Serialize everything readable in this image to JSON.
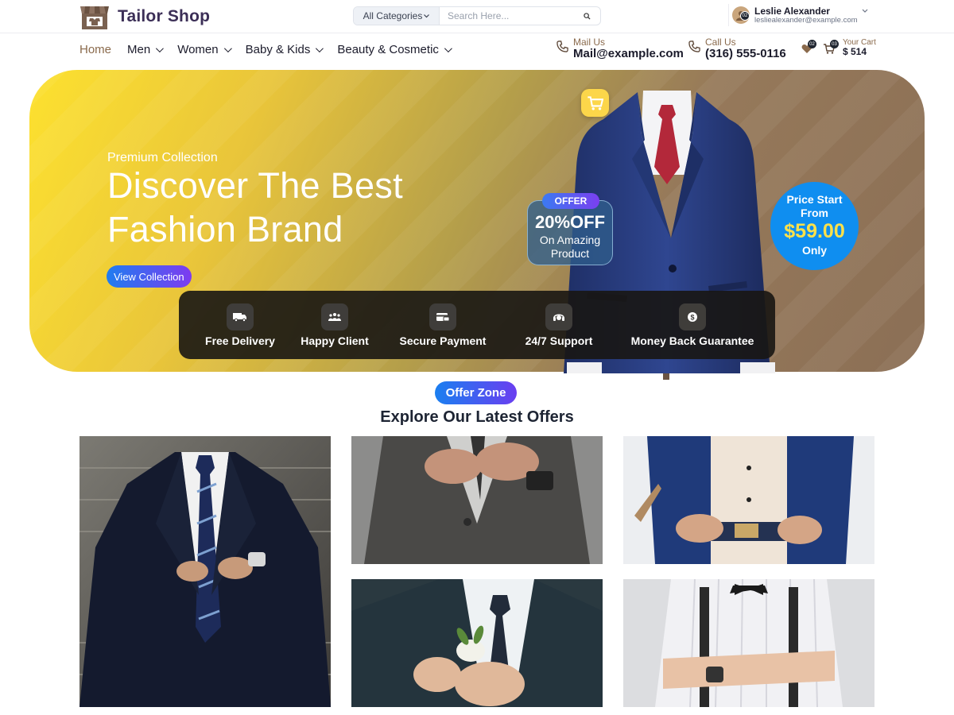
{
  "brand": {
    "name": "Tailor Shop"
  },
  "search": {
    "category": "All Categories",
    "placeholder": "Search Here..."
  },
  "user": {
    "name": "Leslie Alexander",
    "email": "lesliealexander@example.com",
    "badge": "02"
  },
  "nav": {
    "items": [
      {
        "label": "Home",
        "dropdown": false,
        "active": true
      },
      {
        "label": "Men",
        "dropdown": true,
        "active": false
      },
      {
        "label": "Women",
        "dropdown": true,
        "active": false
      },
      {
        "label": "Baby & Kids",
        "dropdown": true,
        "active": false
      },
      {
        "label": "Beauty & Cosmetic",
        "dropdown": true,
        "active": false
      }
    ]
  },
  "contact": {
    "mail_label": "Mail Us",
    "mail_value": "Mail@example.com",
    "call_label": "Call Us",
    "call_value": "(316) 555-0116"
  },
  "cart": {
    "wishlist_badge": "02",
    "cart_badge": "03",
    "label": "Your Cart",
    "value": "$ 514"
  },
  "hero": {
    "subtitle": "Premium Collection",
    "title_line1": "Discover The Best",
    "title_line2": "Fashion Brand",
    "button": "View Collection",
    "offer_tag": "OFFER",
    "offer_pct": "20%OFF",
    "offer_desc1": "On Amazing",
    "offer_desc2": "Product",
    "price_l1": "Price Start",
    "price_l2": "From",
    "price_value": "$59.00",
    "price_l3": "Only"
  },
  "features": [
    {
      "label": "Free Delivery",
      "icon": "truck-icon"
    },
    {
      "label": "Happy Client",
      "icon": "users-icon"
    },
    {
      "label": "Secure Payment",
      "icon": "card-icon"
    },
    {
      "label": "24/7 Support",
      "icon": "headset-icon"
    },
    {
      "label": "Money Back Guarantee",
      "icon": "coin-icon"
    }
  ],
  "offers": {
    "badge": "Offer Zone",
    "title": "Explore Our Latest Offers"
  },
  "colors": {
    "accent": "#8a6a4c",
    "primary_blue": "#0f8ef0",
    "gradient_start": "#1f7df0",
    "gradient_end": "#7e3bf0"
  }
}
